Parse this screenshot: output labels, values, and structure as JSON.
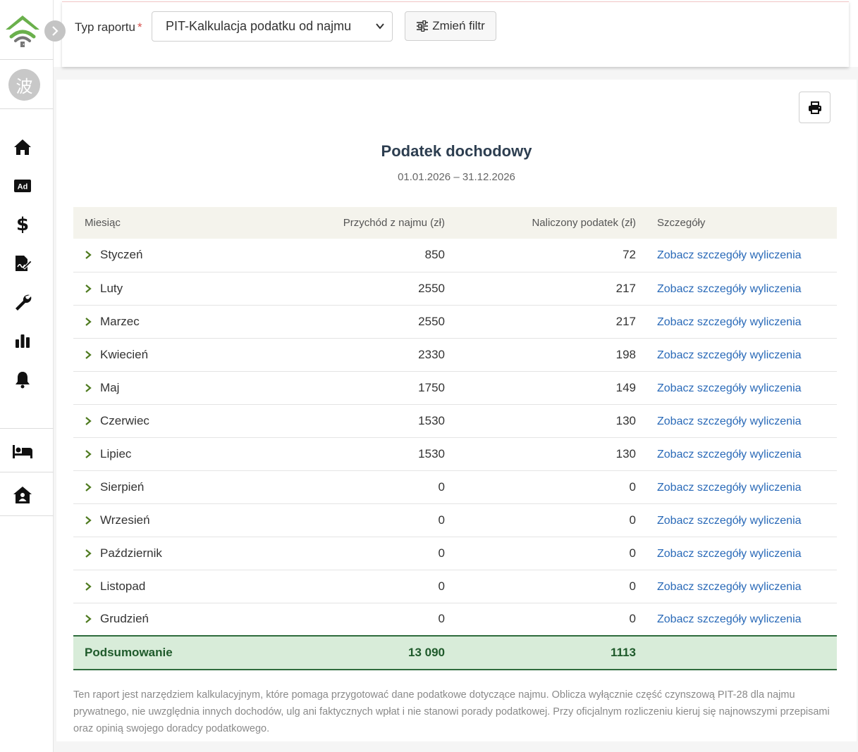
{
  "sidebar": {
    "avatar_text": "波",
    "nav": [
      {
        "icon": "home-icon"
      },
      {
        "icon": "ad-icon",
        "text": "Ad"
      },
      {
        "icon": "dollar-icon"
      },
      {
        "icon": "signature-icon"
      },
      {
        "icon": "wrench-icon"
      },
      {
        "icon": "chart-icon"
      },
      {
        "icon": "bell-icon"
      },
      {
        "icon": "bed-icon"
      },
      {
        "icon": "house-user-icon"
      }
    ]
  },
  "filter": {
    "label": "Typ raportu",
    "required_mark": "*",
    "selected_report": "PIT-Kalkulacja podatku od najmu",
    "change_filter_label": "Zmień filtr"
  },
  "report": {
    "title": "Podatek dochodowy",
    "date_range": "01.01.2026 – 31.12.2026",
    "columns": {
      "month": "Miesiąc",
      "income": "Przychód z najmu (zł)",
      "tax": "Naliczony podatek (zł)",
      "details": "Szczegóły"
    },
    "rows": [
      {
        "month": "Styczeń",
        "income": "850",
        "tax": "72",
        "link": "Zobacz szczegóły wyliczenia"
      },
      {
        "month": "Luty",
        "income": "2550",
        "tax": "217",
        "link": "Zobacz szczegóły wyliczenia"
      },
      {
        "month": "Marzec",
        "income": "2550",
        "tax": "217",
        "link": "Zobacz szczegóły wyliczenia"
      },
      {
        "month": "Kwiecień",
        "income": "2330",
        "tax": "198",
        "link": "Zobacz szczegóły wyliczenia"
      },
      {
        "month": "Maj",
        "income": "1750",
        "tax": "149",
        "link": "Zobacz szczegóły wyliczenia"
      },
      {
        "month": "Czerwiec",
        "income": "1530",
        "tax": "130",
        "link": "Zobacz szczegóły wyliczenia"
      },
      {
        "month": "Lipiec",
        "income": "1530",
        "tax": "130",
        "link": "Zobacz szczegóły wyliczenia"
      },
      {
        "month": "Sierpień",
        "income": "0",
        "tax": "0",
        "link": "Zobacz szczegóły wyliczenia"
      },
      {
        "month": "Wrzesień",
        "income": "0",
        "tax": "0",
        "link": "Zobacz szczegóły wyliczenia"
      },
      {
        "month": "Październik",
        "income": "0",
        "tax": "0",
        "link": "Zobacz szczegóły wyliczenia"
      },
      {
        "month": "Listopad",
        "income": "0",
        "tax": "0",
        "link": "Zobacz szczegóły wyliczenia"
      },
      {
        "month": "Grudzień",
        "income": "0",
        "tax": "0",
        "link": "Zobacz szczegóły wyliczenia"
      }
    ],
    "summary": {
      "label": "Podsumowanie",
      "income_total": "13 090",
      "tax_total": "1113"
    },
    "disclaimer": "Ten raport jest narzędziem kalkulacyjnym, które pomaga przygotować dane podatkowe dotyczące najmu. Oblicza wyłącznie część czynszową PIT-28 dla najmu prywatnego, nie uwzględnia innych dochodów, ulg ani faktycznych wpłat i nie stanowi porady podatkowej. Przy oficjalnym rozliczeniu kieruj się najnowszymi przepisami oraz opinią swojego doradcy podatkowego."
  },
  "colors": {
    "brand_green": "#6ab04c",
    "link_blue": "#2a6ab8",
    "summary_bg": "#d8ecd9",
    "summary_text": "#1f5a2b",
    "header_bg": "#f4f3ec"
  }
}
